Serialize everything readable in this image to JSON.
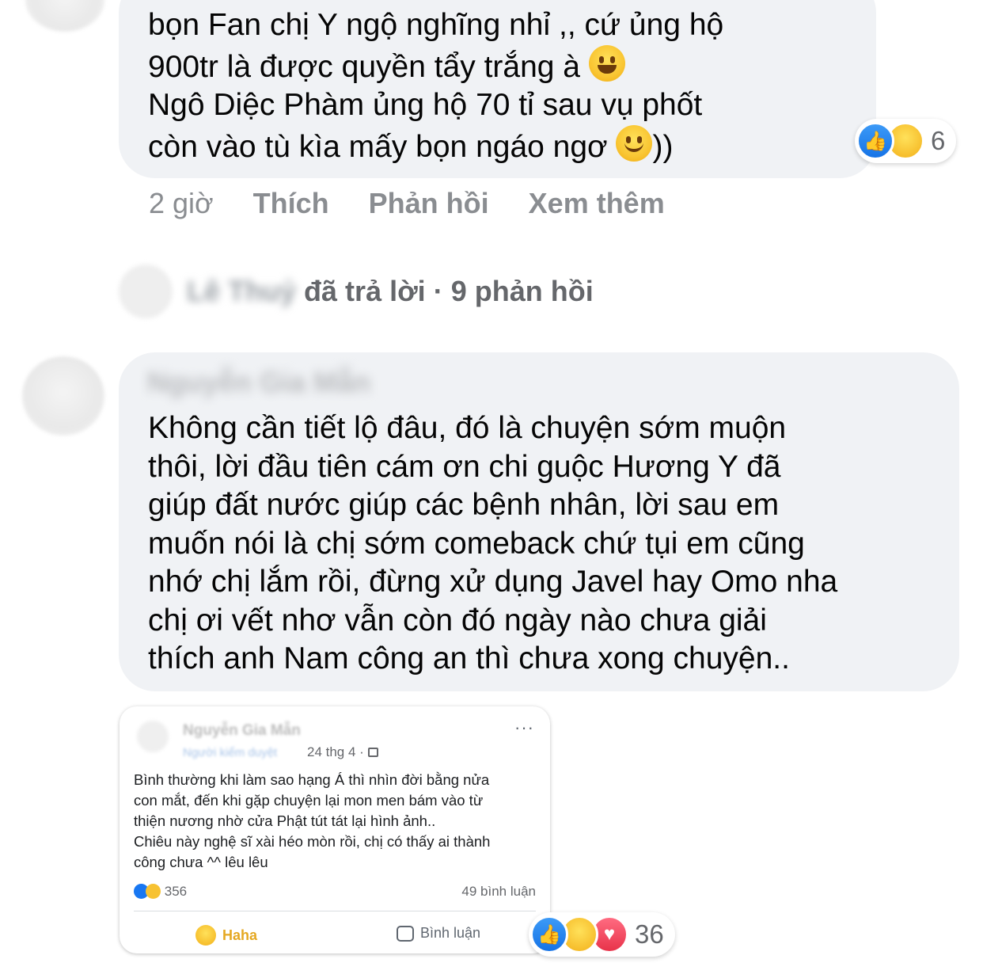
{
  "comment1": {
    "lines": [
      "bọn Fan chị Y ngộ nghĩng nhỉ ,, cứ ủng hộ",
      "900tr là được quyền tẩy trắng à",
      "Ngô Diệc Phàm ủng hộ 70 tỉ sau vụ phốt",
      "còn vào tù kìa mấy bọn ngáo ngơ",
      "))"
    ],
    "reaction_count": "6",
    "actions": {
      "time": "2 giờ",
      "like": "Thích",
      "reply": "Phản hồi",
      "more": "Xem thêm"
    }
  },
  "reply_summary": {
    "name": "Lê Thuỷ",
    "text": "đã trả lời",
    "separator": "·",
    "count": "9 phản hồi"
  },
  "comment2": {
    "author": "Nguyễn Gia Mẫn",
    "lines": [
      "Không cần tiết lộ đâu, đó là chuyện sớm muộn",
      "thôi, lời đầu tiên cám ơn chi guộc Hương Y đã",
      "giúp đất nước giúp các bệnh nhân, lời sau em",
      "muốn nói là chị sớm comeback chứ tụi em cũng",
      "nhớ chị lắm rồi, đừng xử dụng Javel hay Omo nha",
      "chị ơi vết nhơ vẫn còn đó ngày nào chưa giải",
      "thích anh Nam công an thì chưa xong chuyện.."
    ],
    "reaction_count": "36"
  },
  "embedded_post": {
    "name": "Nguyễn Gia Mẫn",
    "role": "Người kiểm duyệt",
    "date": "24 thg 4 · ",
    "more": "···",
    "body_lines": [
      "Bình thường khi làm sao hạng Á thì nhìn đời bằng nửa",
      "con mắt, đến khi gặp chuyện lại mon men bám vào từ",
      "thiện nương nhờ cửa Phật tút tát lại hình ảnh..",
      "Chiêu này nghệ sĩ xài héo mòn rồi, chị có thấy ai thành",
      "công chưa ^^ lêu lêu"
    ],
    "reaction_count": "356",
    "comment_count": "49 bình luận",
    "haha_label": "Haha",
    "comment_label": "Bình luận"
  }
}
